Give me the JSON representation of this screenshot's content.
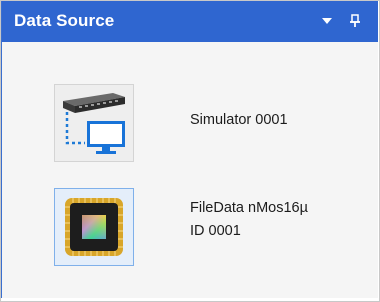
{
  "panel": {
    "title": "Data Source",
    "controls": {
      "dropdown_icon": "chevron-down-icon",
      "pin_icon": "pin-icon"
    }
  },
  "sources": [
    {
      "label_lines": [
        "Simulator 0001"
      ],
      "icon": "simulator-icon",
      "selected": false
    },
    {
      "label_lines": [
        "FileData nMos16µ",
        "ID 0001"
      ],
      "icon": "chip-icon",
      "selected": true
    }
  ],
  "colors": {
    "title_bar": "#2f66d0",
    "panel_bg": "#f5f5f5",
    "selection_border": "#7fb0ea",
    "chip_gold": "#d8a62a"
  }
}
